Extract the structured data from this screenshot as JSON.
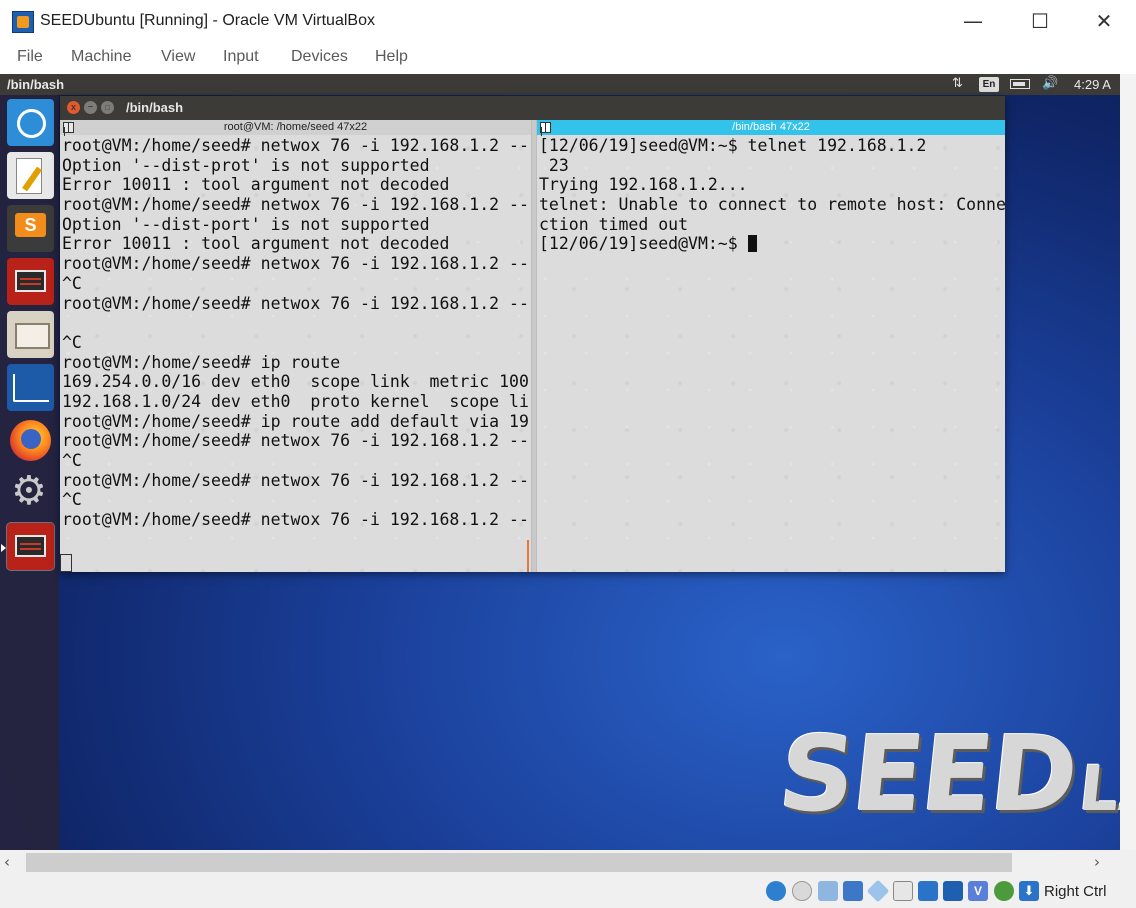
{
  "vbox": {
    "title": "SEEDUbuntu [Running] - Oracle VM VirtualBox",
    "controls": {
      "minimize": "—",
      "maximize": "☐",
      "close": "✕"
    },
    "menu": [
      "File",
      "Machine",
      "View",
      "Input",
      "Devices",
      "Help"
    ],
    "host_key": "Right Ctrl"
  },
  "guest_topbar": {
    "title": "/bin/bash",
    "lang": "En",
    "clock": "4:29 A"
  },
  "launcher": {
    "items": [
      "dash-home",
      "text-editor",
      "sublime-text",
      "terminal",
      "files",
      "wireshark",
      "firefox",
      "system-settings",
      "terminal"
    ]
  },
  "terminal_window": {
    "title": "/bin/bash",
    "buttons": {
      "close": "x",
      "minimize": "–",
      "maximize": "□"
    },
    "left_pane": {
      "header": "root@VM: /home/seed 47x22",
      "lines": [
        "root@VM:/home/seed# netwox 76 -i 192.168.1.2 --",
        "Option '--dist-prot' is not supported",
        "Error 10011 : tool argument not decoded",
        "root@VM:/home/seed# netwox 76 -i 192.168.1.2 --",
        "Option '--dist-port' is not supported",
        "Error 10011 : tool argument not decoded",
        "root@VM:/home/seed# netwox 76 -i 192.168.1.2 --",
        "^C",
        "root@VM:/home/seed# netwox 76 -i 192.168.1.2 --",
        "",
        "^C",
        "root@VM:/home/seed# ip route",
        "169.254.0.0/16 dev eth0  scope link  metric 100",
        "192.168.1.0/24 dev eth0  proto kernel  scope li",
        "root@VM:/home/seed# ip route add default via 19",
        "root@VM:/home/seed# netwox 76 -i 192.168.1.2 --",
        "^C",
        "root@VM:/home/seed# netwox 76 -i 192.168.1.2 --",
        "^C",
        "root@VM:/home/seed# netwox 76 -i 192.168.1.2 --"
      ]
    },
    "right_pane": {
      "header": "/bin/bash 47x22",
      "lines": [
        "[12/06/19]seed@VM:~$ telnet 192.168.1.2",
        " 23",
        "Trying 192.168.1.2...",
        "telnet: Unable to connect to remote host: Conne",
        "ction timed out"
      ],
      "prompt": "[12/06/19]seed@VM:~$ "
    }
  },
  "wallpaper": {
    "logo_big": "SEED",
    "logo_small": "LABS"
  },
  "statusbar": {
    "cpu_label": "V",
    "keyboard_label": "⬇"
  },
  "colors": {
    "accent": "#33c3ea",
    "topbar": "#3c3b37",
    "close_button": "#e05a2c"
  }
}
